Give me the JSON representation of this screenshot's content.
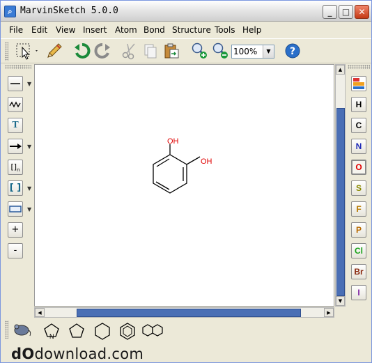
{
  "window": {
    "title": "MarvinSketch 5.0.0",
    "minimize": "_",
    "maximize": "□",
    "close": "✕"
  },
  "menu": [
    "File",
    "Edit",
    "View",
    "Insert",
    "Atom",
    "Bond",
    "Structure",
    "Tools",
    "Help"
  ],
  "toolbar": {
    "zoom_value": "100%",
    "icons": [
      "select-icon",
      "eraser-pencil-icon",
      "undo-icon",
      "redo-icon",
      "cut-icon",
      "copy-icon",
      "paste-icon",
      "zoom-in-icon",
      "zoom-out-icon",
      "help-icon"
    ]
  },
  "left_tools": {
    "text_tool": "T",
    "group_tool": "[]",
    "group_sub": "n",
    "bracket_tool": "[ ]",
    "plus": "+",
    "minus": "-"
  },
  "elements": [
    "H",
    "C",
    "N",
    "O",
    "S",
    "F",
    "P",
    "Cl",
    "Br",
    "I"
  ],
  "element_colors": {
    "H": "#000000",
    "C": "#000000",
    "N": "#1f2bb8",
    "O": "#e00000",
    "S": "#8a8a00",
    "F": "#b87a00",
    "P": "#b86a00",
    "Cl": "#16a016",
    "Br": "#8a2a10",
    "I": "#7a1aa0"
  },
  "molecule": {
    "labels": [
      "OH",
      "OH"
    ],
    "label_color": "#e00000"
  },
  "bottom_templates": [
    "pyrrole-template",
    "pentagon-template",
    "hexagon-template",
    "benzene-template",
    "naphthalene-template"
  ],
  "watermark": {
    "prefix": "dO",
    "text": "download.com"
  }
}
